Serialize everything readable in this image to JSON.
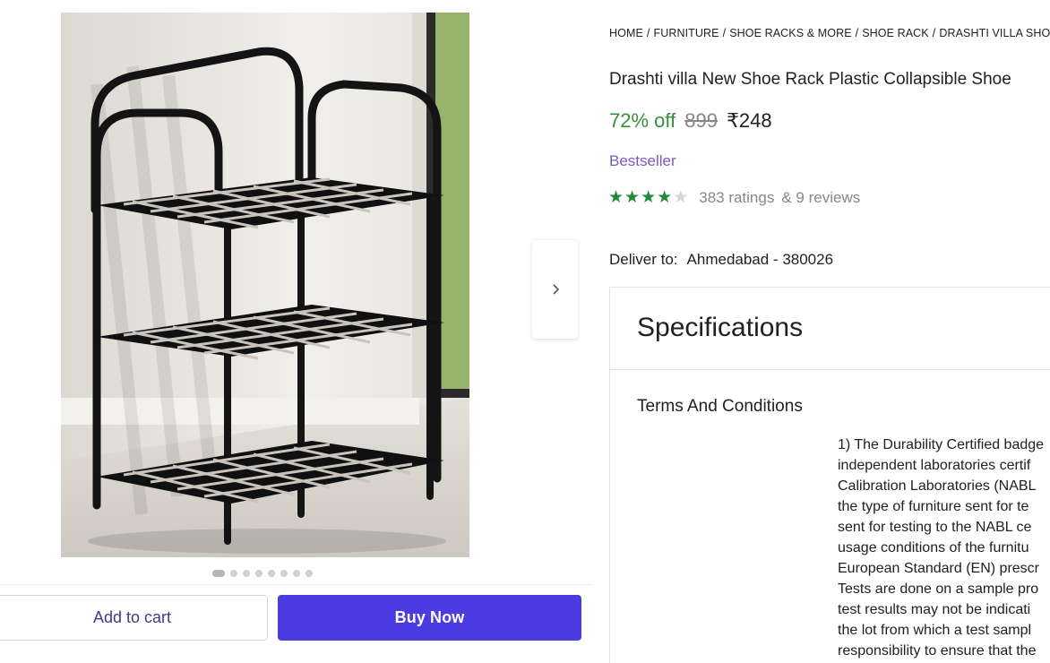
{
  "gallery": {
    "image_count": 8,
    "active_index": 0
  },
  "buttons": {
    "add_to_cart": "Add to cart",
    "buy_now": "Buy Now"
  },
  "breadcrumb": [
    "HOME",
    "FURNITURE",
    "SHOE RACKS & MORE",
    "SHOE RACK",
    "DRASHTI VILLA SHOE R"
  ],
  "breadcrumb_sep": "/",
  "product": {
    "title": "Drashti villa New Shoe Rack Plastic Collapsible Shoe",
    "discount": "72% off",
    "mrp": "899",
    "price": "₹248",
    "badge": "Bestseller",
    "rating_value": 4,
    "rating_max": 5,
    "ratings": "383 ratings",
    "reviews": "& 9 reviews"
  },
  "delivery": {
    "label": "Deliver to:",
    "location": "Ahmedabad - 380026"
  },
  "specifications": {
    "title": "Specifications",
    "terms_title": "Terms And Conditions",
    "terms_lines": [
      "1) The Durability Certified badge",
      "independent laboratories certif",
      "Calibration Laboratories (NABL",
      "the type of furniture sent for te",
      "sent for testing to the NABL ce",
      "usage conditions of the furnitu",
      "European Standard (EN) prescr",
      "Tests are done on a sample pro",
      "test results may not be indicati",
      "the lot from which a test sampl",
      "responsibility to ensure that the"
    ]
  },
  "colors": {
    "discount": "#388e3c",
    "buy_now_bg": "#4b3be0",
    "badge": "#7e57c2",
    "star": "#1f8a3b"
  }
}
